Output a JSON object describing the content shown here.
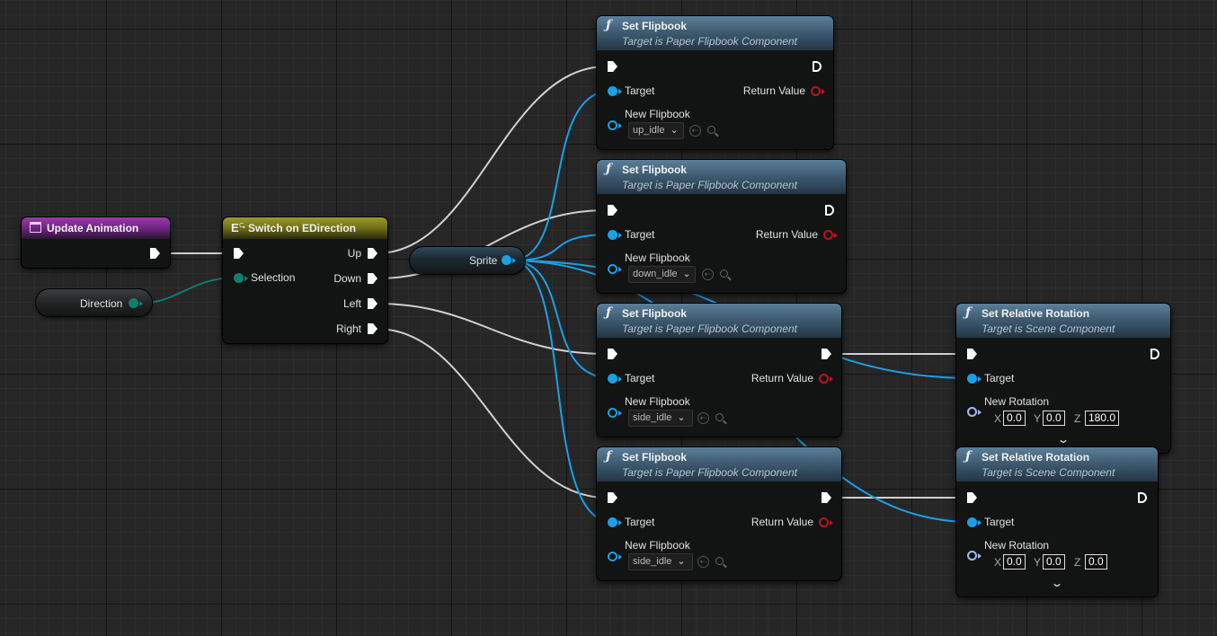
{
  "colors": {
    "exec_wire": "#d8d8d8",
    "object_wire": "#1aa0e8",
    "enum_wire": "#0f7d71",
    "function_header": "#3f5c72",
    "event_header": "#7a2a86",
    "switch_header": "#7d7d1c",
    "return_pin": "#c0121a"
  },
  "event_node": {
    "title": "Update Animation",
    "icon": "event-icon"
  },
  "direction_var": {
    "label": "Direction"
  },
  "switch_node": {
    "title": "Switch on EDirection",
    "icon": "switch-icon",
    "selection_label": "Selection",
    "outputs": [
      "Up",
      "Down",
      "Left",
      "Right"
    ]
  },
  "sprite_var": {
    "label": "Sprite"
  },
  "flipbook_nodes": [
    {
      "title": "Set Flipbook",
      "subtitle": "Target is Paper Flipbook Component",
      "target_label": "Target",
      "return_label": "Return Value",
      "flipbook_label": "New Flipbook",
      "flipbook_value": "up_idle"
    },
    {
      "title": "Set Flipbook",
      "subtitle": "Target is Paper Flipbook Component",
      "target_label": "Target",
      "return_label": "Return Value",
      "flipbook_label": "New Flipbook",
      "flipbook_value": "down_idle"
    },
    {
      "title": "Set Flipbook",
      "subtitle": "Target is Paper Flipbook Component",
      "target_label": "Target",
      "return_label": "Return Value",
      "flipbook_label": "New Flipbook",
      "flipbook_value": "side_idle"
    },
    {
      "title": "Set Flipbook",
      "subtitle": "Target is Paper Flipbook Component",
      "target_label": "Target",
      "return_label": "Return Value",
      "flipbook_label": "New Flipbook",
      "flipbook_value": "side_idle"
    }
  ],
  "rotation_nodes": [
    {
      "title": "Set Relative Rotation",
      "subtitle": "Target is Scene Component",
      "target_label": "Target",
      "rotation_label": "New Rotation",
      "x_label": "X",
      "y_label": "Y",
      "z_label": "Z",
      "x": "0.0",
      "y": "0.0",
      "z": "180.0"
    },
    {
      "title": "Set Relative Rotation",
      "subtitle": "Target is Scene Component",
      "target_label": "Target",
      "rotation_label": "New Rotation",
      "x_label": "X",
      "y_label": "Y",
      "z_label": "Z",
      "x": "0.0",
      "y": "0.0",
      "z": "0.0"
    }
  ],
  "fn_icon": "ƒ"
}
